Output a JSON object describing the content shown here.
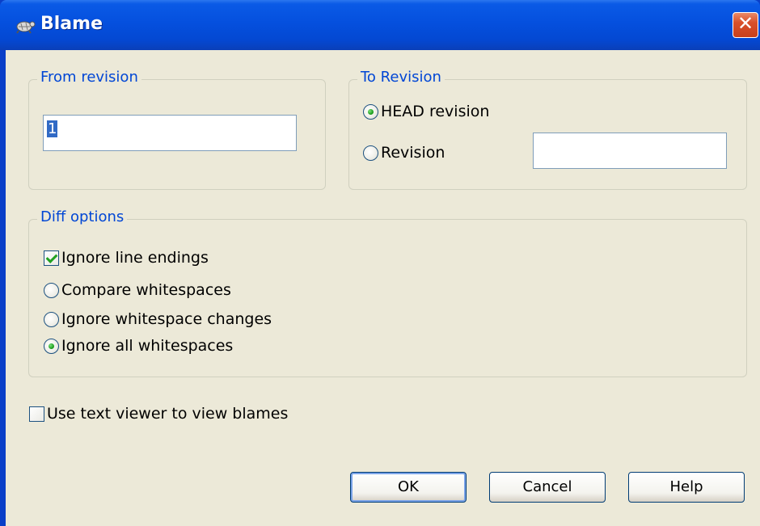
{
  "window": {
    "title": "Blame",
    "icon": "tortoise-icon",
    "close_glyph": "✕"
  },
  "from_revision": {
    "group_label": "From revision",
    "value": "1"
  },
  "to_revision": {
    "group_label": "To Revision",
    "head_label": "HEAD revision",
    "revision_label": "Revision",
    "revision_value": "",
    "selected": "HEAD revision"
  },
  "diff_options": {
    "group_label": "Diff options",
    "ignore_line_endings_label": "Ignore line endings",
    "ignore_line_endings_checked": true,
    "compare_whitespaces_label": "Compare whitespaces",
    "ignore_whitespace_changes_label": "Ignore whitespace changes",
    "ignore_all_whitespaces_label": "Ignore all whitespaces",
    "selected": "Ignore all whitespaces"
  },
  "use_text_viewer": {
    "label": "Use text viewer to view blames",
    "checked": false
  },
  "buttons": {
    "ok": "OK",
    "cancel": "Cancel",
    "help": "Help"
  }
}
